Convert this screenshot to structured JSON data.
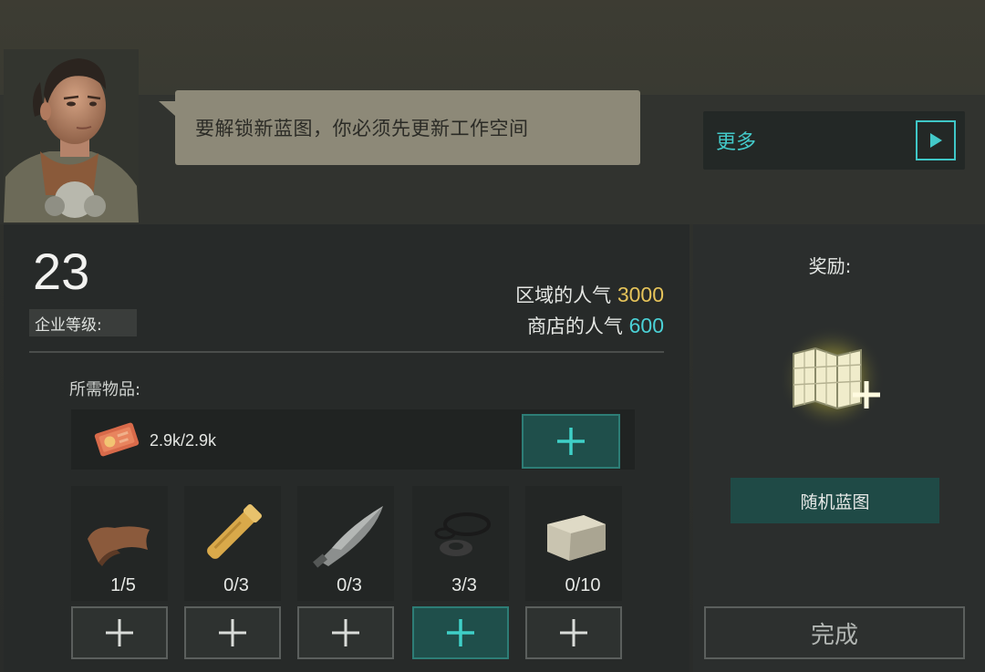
{
  "dialog": {
    "message": "要解锁新蓝图，你必须先更新工作空间"
  },
  "more_button": {
    "label": "更多",
    "icon": "play-triangle-icon"
  },
  "company": {
    "level_value": "23",
    "level_label": "企业等级:"
  },
  "popularity": {
    "region_label": "区域的人气",
    "region_value": "3000",
    "store_label": "商店的人气",
    "store_value": "600"
  },
  "requirements": {
    "title": "所需物品:",
    "currency": {
      "icon": "ticket-currency-icon",
      "amount": "2.9k/2.9k"
    },
    "items": [
      {
        "icon": "leather-icon",
        "count": "1/5"
      },
      {
        "icon": "wooden-handle-icon",
        "count": "0/3"
      },
      {
        "icon": "knife-blade-icon",
        "count": "0/3"
      },
      {
        "icon": "gasket-rings-icon",
        "count": "3/3"
      },
      {
        "icon": "stone-block-icon",
        "count": "0/10"
      }
    ]
  },
  "reward": {
    "title": "奖励:",
    "icon": "blueprint-map-plus-icon",
    "button_label": "随机蓝图"
  },
  "done_button": {
    "label": "完成"
  },
  "colors": {
    "accent_cyan": "#43c9c9",
    "gold": "#e5c35a",
    "active_button": "#1f4f4b",
    "bubble": "#8d8978"
  }
}
